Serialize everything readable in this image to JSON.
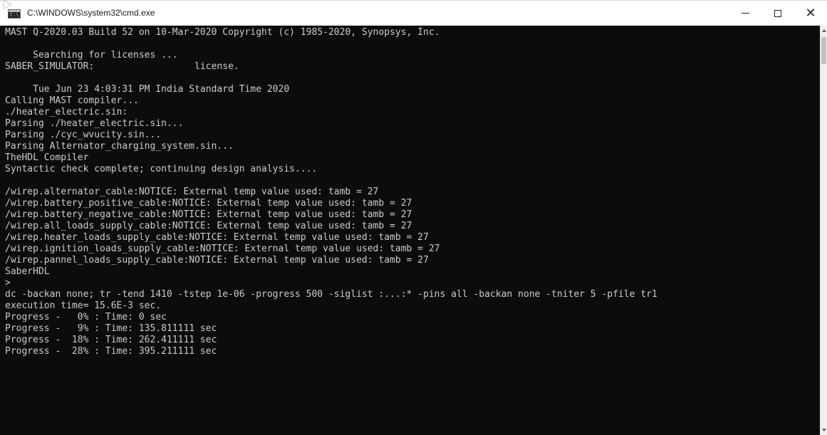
{
  "window": {
    "title": "C:\\WINDOWS\\system32\\cmd.exe",
    "icon": "cmd-icon",
    "controls": {
      "minimize": "minimize-icon",
      "maximize": "maximize-icon",
      "close": "close-icon"
    }
  },
  "console": {
    "lines": [
      "MAST Q-2020.03 Build 52 on 10-Mar-2020 Copyright (c) 1985-2020, Synopsys, Inc.",
      "",
      "     Searching for licenses ...",
      "SABER_SIMULATOR:                  license.",
      "",
      "     Tue Jun 23 4:03:31 PM India Standard Time 2020",
      "Calling MAST compiler...",
      "./heater_electric.sin:",
      "Parsing ./heater_electric.sin...",
      "Parsing ./cyc_wvucity.sin...",
      "Parsing Alternator_charging_system.sin...",
      "TheHDL Compiler",
      "Syntactic check complete; continuing design analysis....",
      "",
      "/wirep.alternator_cable:NOTICE: External temp value used: tamb = 27",
      "/wirep.battery_positive_cable:NOTICE: External temp value used: tamb = 27",
      "/wirep.battery_negative_cable:NOTICE: External temp value used: tamb = 27",
      "/wirep.all_loads_supply_cable:NOTICE: External temp value used: tamb = 27",
      "/wirep.heater_loads_supply_cable:NOTICE: External temp value used: tamb = 27",
      "/wirep.ignition_loads_supply_cable:NOTICE: External temp value used: tamb = 27",
      "/wirep.pannel_loads_supply_cable:NOTICE: External temp value used: tamb = 27",
      "SaberHDL",
      ">",
      "dc -backan none; tr -tend 1410 -tstep 1e-06 -progress 500 -siglist :...:* -pins all -backan none -tniter 5 -pfile tr1",
      "execution time= 15.6E-3 sec.",
      "Progress -   0% : Time: 0 sec",
      "Progress -   9% : Time: 135.811111 sec",
      "Progress -  18% : Time: 262.411111 sec",
      "Progress -  28% : Time: 395.211111 sec"
    ]
  },
  "scrollbar": {
    "up_icon": "scroll-up-arrow-icon",
    "down_icon": "scroll-down-arrow-icon"
  }
}
